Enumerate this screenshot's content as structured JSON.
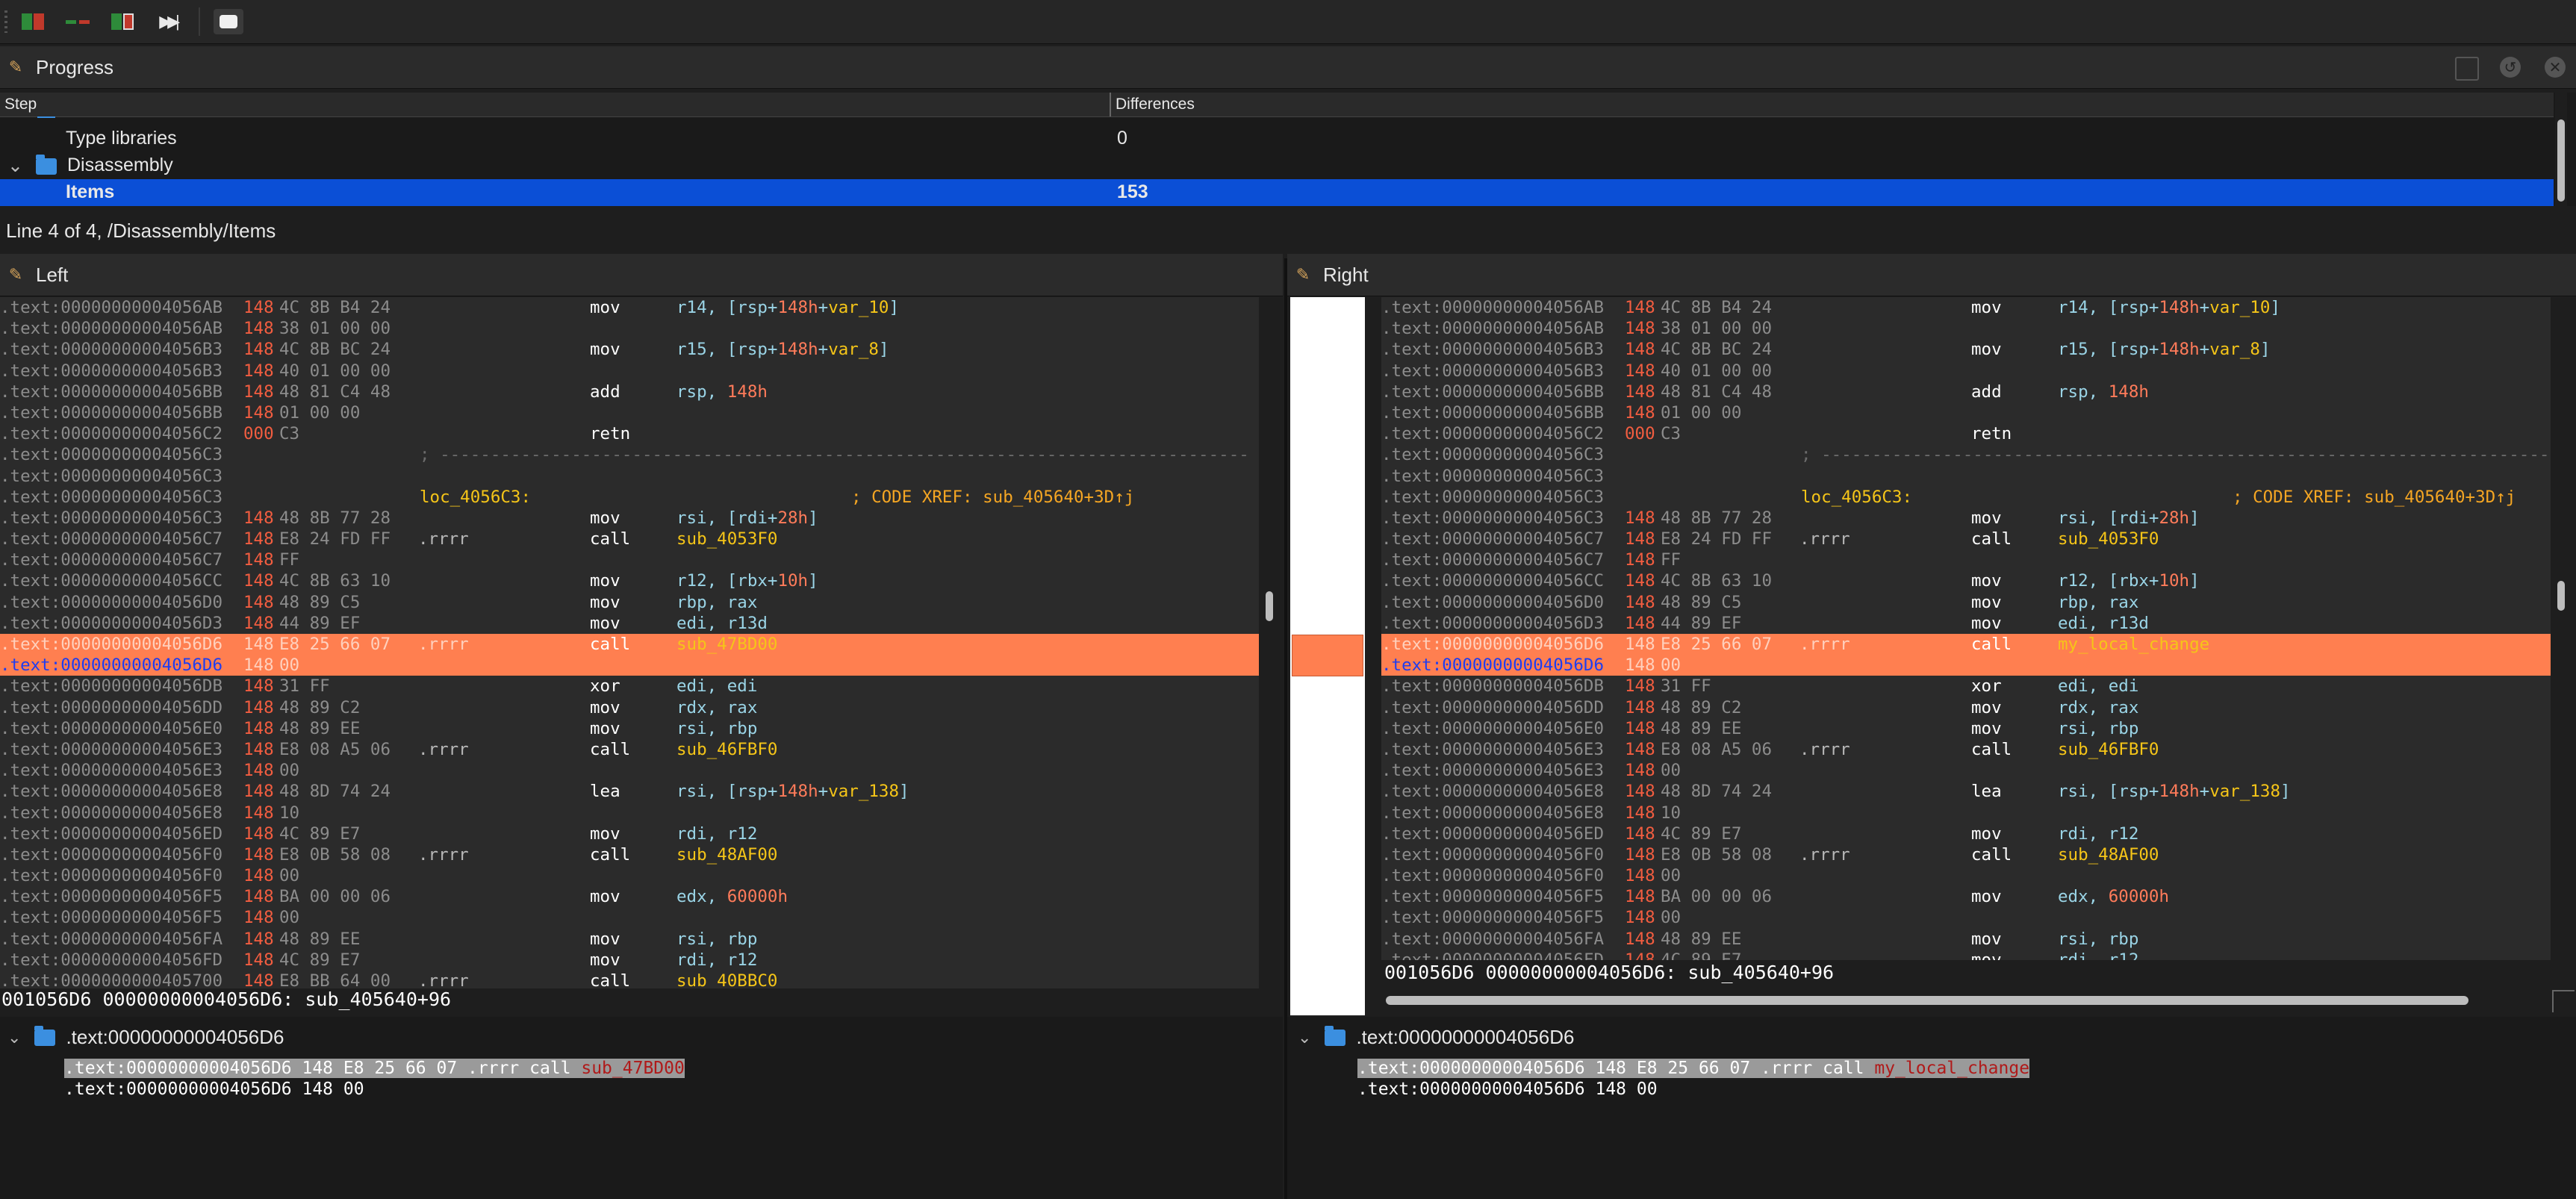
{
  "toolbar": {
    "buttons": [
      {
        "name": "open-diff-icon"
      },
      {
        "name": "prev-diff-icon"
      },
      {
        "name": "next-diff-icon"
      },
      {
        "name": "fast-forward-icon"
      },
      {
        "name": "comment-icon"
      }
    ]
  },
  "progress": {
    "title": "Progress",
    "columns": [
      "Step",
      "Differences"
    ],
    "rows": [
      {
        "step": "Type libraries",
        "diff": "0"
      },
      {
        "step": "Disassembly",
        "diff": ""
      },
      {
        "step": "Items",
        "diff": "153"
      }
    ],
    "status": "Line 4 of 4, /Disassembly/Items"
  },
  "left": {
    "title": "Left",
    "status": "001056D6 00000000004056D6: sub_405640+96",
    "tree_header": ".text:00000000004056D6",
    "tree_line1_pre": ".text:00000000004056D6 148 E8 25 66 07 .rrrr call ",
    "tree_line1_sym": "sub_47BD00",
    "tree_line2": ".text:00000000004056D6 148 00",
    "lines": [
      {
        "a": ".text:00000000004056AB",
        "c": "148",
        "b": "4C 8B B4 24",
        "m": "mov",
        "o": [
          [
            "op",
            "r14, [rsp+"
          ],
          [
            "num",
            "148h"
          ],
          [
            "op",
            "+"
          ],
          [
            "lbl",
            "var_10"
          ],
          [
            "op",
            "]"
          ]
        ]
      },
      {
        "a": ".text:00000000004056AB",
        "c": "148",
        "b": "38 01 00 00"
      },
      {
        "a": ".text:00000000004056B3",
        "c": "148",
        "b": "4C 8B BC 24",
        "m": "mov",
        "o": [
          [
            "op",
            "r15, [rsp+"
          ],
          [
            "num",
            "148h"
          ],
          [
            "op",
            "+"
          ],
          [
            "lbl",
            "var_8"
          ],
          [
            "op",
            "]"
          ]
        ]
      },
      {
        "a": ".text:00000000004056B3",
        "c": "148",
        "b": "40 01 00 00"
      },
      {
        "a": ".text:00000000004056BB",
        "c": "148",
        "b": "48 81 C4 48",
        "m": "add",
        "o": [
          [
            "op",
            "rsp, "
          ],
          [
            "num",
            "148h"
          ]
        ]
      },
      {
        "a": ".text:00000000004056BB",
        "c": "148",
        "b": "01 00 00"
      },
      {
        "a": ".text:00000000004056C2",
        "c": "000",
        "b": "C3",
        "m": "retn"
      },
      {
        "a": ".text:00000000004056C3",
        "sep": true
      },
      {
        "a": ".text:00000000004056C3"
      },
      {
        "a": ".text:00000000004056C3",
        "label": "loc_4056C3:",
        "cmt": "; CODE XREF: sub_405640+3D↑j"
      },
      {
        "a": ".text:00000000004056C3",
        "c": "148",
        "b": "48 8B 77 28",
        "m": "mov",
        "o": [
          [
            "op",
            "rsi, [rdi+"
          ],
          [
            "num",
            "28h"
          ],
          [
            "op",
            "]"
          ]
        ]
      },
      {
        "a": ".text:00000000004056C7",
        "c": "148",
        "b": "E8 24 FD FF",
        "r": ".rrrr",
        "m": "call",
        "o": [
          [
            "lbl",
            "sub_4053F0"
          ]
        ]
      },
      {
        "a": ".text:00000000004056C7",
        "c": "148",
        "b": "FF"
      },
      {
        "a": ".text:00000000004056CC",
        "c": "148",
        "b": "4C 8B 63 10",
        "m": "mov",
        "o": [
          [
            "op",
            "r12, [rbx+"
          ],
          [
            "num",
            "10h"
          ],
          [
            "op",
            "]"
          ]
        ]
      },
      {
        "a": ".text:00000000004056D0",
        "c": "148",
        "b": "48 89 C5",
        "m": "mov",
        "o": [
          [
            "op",
            "rbp, rax"
          ]
        ]
      },
      {
        "a": ".text:00000000004056D3",
        "c": "148",
        "b": "44 89 EF",
        "m": "mov",
        "o": [
          [
            "op",
            "edi, r13d"
          ]
        ]
      },
      {
        "a": ".text:00000000004056D6",
        "c": "148",
        "b": "E8 25 66 07",
        "r": ".rrrr",
        "m": "call",
        "o": [
          [
            "lbl",
            "sub_47BD00"
          ]
        ],
        "hl": 1
      },
      {
        "a": ".text:00000000004056D6",
        "c": "148",
        "b": "00",
        "hl": 2
      },
      {
        "a": ".text:00000000004056DB",
        "c": "148",
        "b": "31 FF",
        "m": "xor",
        "o": [
          [
            "op",
            "edi, edi"
          ]
        ]
      },
      {
        "a": ".text:00000000004056DD",
        "c": "148",
        "b": "48 89 C2",
        "m": "mov",
        "o": [
          [
            "op",
            "rdx, rax"
          ]
        ]
      },
      {
        "a": ".text:00000000004056E0",
        "c": "148",
        "b": "48 89 EE",
        "m": "mov",
        "o": [
          [
            "op",
            "rsi, rbp"
          ]
        ]
      },
      {
        "a": ".text:00000000004056E3",
        "c": "148",
        "b": "E8 08 A5 06",
        "r": ".rrrr",
        "m": "call",
        "o": [
          [
            "lbl",
            "sub_46FBF0"
          ]
        ]
      },
      {
        "a": ".text:00000000004056E3",
        "c": "148",
        "b": "00"
      },
      {
        "a": ".text:00000000004056E8",
        "c": "148",
        "b": "48 8D 74 24",
        "m": "lea",
        "o": [
          [
            "op",
            "rsi, [rsp+"
          ],
          [
            "num",
            "148h"
          ],
          [
            "op",
            "+"
          ],
          [
            "lbl",
            "var_138"
          ],
          [
            "op",
            "]"
          ]
        ]
      },
      {
        "a": ".text:00000000004056E8",
        "c": "148",
        "b": "10"
      },
      {
        "a": ".text:00000000004056ED",
        "c": "148",
        "b": "4C 89 E7",
        "m": "mov",
        "o": [
          [
            "op",
            "rdi, r12"
          ]
        ]
      },
      {
        "a": ".text:00000000004056F0",
        "c": "148",
        "b": "E8 0B 58 08",
        "r": ".rrrr",
        "m": "call",
        "o": [
          [
            "lbl",
            "sub_48AF00"
          ]
        ]
      },
      {
        "a": ".text:00000000004056F0",
        "c": "148",
        "b": "00"
      },
      {
        "a": ".text:00000000004056F5",
        "c": "148",
        "b": "BA 00 00 06",
        "m": "mov",
        "o": [
          [
            "op",
            "edx, "
          ],
          [
            "num",
            "60000h"
          ]
        ]
      },
      {
        "a": ".text:00000000004056F5",
        "c": "148",
        "b": "00"
      },
      {
        "a": ".text:00000000004056FA",
        "c": "148",
        "b": "48 89 EE",
        "m": "mov",
        "o": [
          [
            "op",
            "rsi, rbp"
          ]
        ]
      },
      {
        "a": ".text:00000000004056FD",
        "c": "148",
        "b": "4C 89 E7",
        "m": "mov",
        "o": [
          [
            "op",
            "rdi, r12"
          ]
        ]
      },
      {
        "a": ".text:0000000000405700",
        "c": "148",
        "b": "E8 BB 64 00",
        "r": ".rrrr",
        "m": "call",
        "o": [
          [
            "lbl",
            "sub_40BBC0"
          ]
        ]
      }
    ]
  },
  "right": {
    "title": "Right",
    "status": "001056D6 00000000004056D6: sub_405640+96",
    "tree_header": ".text:00000000004056D6",
    "tree_line1_pre": ".text:00000000004056D6 148 E8 25 66 07 .rrrr call ",
    "tree_line1_sym": "my_local_change",
    "tree_line2": ".text:00000000004056D6 148 00",
    "lines": [
      {
        "a": ".text:00000000004056AB",
        "c": "148",
        "b": "4C 8B B4 24",
        "m": "mov",
        "o": [
          [
            "op",
            "r14, [rsp+"
          ],
          [
            "num",
            "148h"
          ],
          [
            "op",
            "+"
          ],
          [
            "lbl",
            "var_10"
          ],
          [
            "op",
            "]"
          ]
        ]
      },
      {
        "a": ".text:00000000004056AB",
        "c": "148",
        "b": "38 01 00 00"
      },
      {
        "a": ".text:00000000004056B3",
        "c": "148",
        "b": "4C 8B BC 24",
        "m": "mov",
        "o": [
          [
            "op",
            "r15, [rsp+"
          ],
          [
            "num",
            "148h"
          ],
          [
            "op",
            "+"
          ],
          [
            "lbl",
            "var_8"
          ],
          [
            "op",
            "]"
          ]
        ]
      },
      {
        "a": ".text:00000000004056B3",
        "c": "148",
        "b": "40 01 00 00"
      },
      {
        "a": ".text:00000000004056BB",
        "c": "148",
        "b": "48 81 C4 48",
        "m": "add",
        "o": [
          [
            "op",
            "rsp, "
          ],
          [
            "num",
            "148h"
          ]
        ]
      },
      {
        "a": ".text:00000000004056BB",
        "c": "148",
        "b": "01 00 00"
      },
      {
        "a": ".text:00000000004056C2",
        "c": "000",
        "b": "C3",
        "m": "retn"
      },
      {
        "a": ".text:00000000004056C3",
        "sep": true
      },
      {
        "a": ".text:00000000004056C3"
      },
      {
        "a": ".text:00000000004056C3",
        "label": "loc_4056C3:",
        "cmt": "; CODE XREF: sub_405640+3D↑j"
      },
      {
        "a": ".text:00000000004056C3",
        "c": "148",
        "b": "48 8B 77 28",
        "m": "mov",
        "o": [
          [
            "op",
            "rsi, [rdi+"
          ],
          [
            "num",
            "28h"
          ],
          [
            "op",
            "]"
          ]
        ]
      },
      {
        "a": ".text:00000000004056C7",
        "c": "148",
        "b": "E8 24 FD FF",
        "r": ".rrrr",
        "m": "call",
        "o": [
          [
            "lbl",
            "sub_4053F0"
          ]
        ]
      },
      {
        "a": ".text:00000000004056C7",
        "c": "148",
        "b": "FF"
      },
      {
        "a": ".text:00000000004056CC",
        "c": "148",
        "b": "4C 8B 63 10",
        "m": "mov",
        "o": [
          [
            "op",
            "r12, [rbx+"
          ],
          [
            "num",
            "10h"
          ],
          [
            "op",
            "]"
          ]
        ]
      },
      {
        "a": ".text:00000000004056D0",
        "c": "148",
        "b": "48 89 C5",
        "m": "mov",
        "o": [
          [
            "op",
            "rbp, rax"
          ]
        ]
      },
      {
        "a": ".text:00000000004056D3",
        "c": "148",
        "b": "44 89 EF",
        "m": "mov",
        "o": [
          [
            "op",
            "edi, r13d"
          ]
        ]
      },
      {
        "a": ".text:00000000004056D6",
        "c": "148",
        "b": "E8 25 66 07",
        "r": ".rrrr",
        "m": "call",
        "o": [
          [
            "lbl",
            "my_local_change"
          ]
        ],
        "hl": 1
      },
      {
        "a": ".text:00000000004056D6",
        "c": "148",
        "b": "00",
        "hl": 2
      },
      {
        "a": ".text:00000000004056DB",
        "c": "148",
        "b": "31 FF",
        "m": "xor",
        "o": [
          [
            "op",
            "edi, edi"
          ]
        ]
      },
      {
        "a": ".text:00000000004056DD",
        "c": "148",
        "b": "48 89 C2",
        "m": "mov",
        "o": [
          [
            "op",
            "rdx, rax"
          ]
        ]
      },
      {
        "a": ".text:00000000004056E0",
        "c": "148",
        "b": "48 89 EE",
        "m": "mov",
        "o": [
          [
            "op",
            "rsi, rbp"
          ]
        ]
      },
      {
        "a": ".text:00000000004056E3",
        "c": "148",
        "b": "E8 08 A5 06",
        "r": ".rrrr",
        "m": "call",
        "o": [
          [
            "lbl",
            "sub_46FBF0"
          ]
        ]
      },
      {
        "a": ".text:00000000004056E3",
        "c": "148",
        "b": "00"
      },
      {
        "a": ".text:00000000004056E8",
        "c": "148",
        "b": "48 8D 74 24",
        "m": "lea",
        "o": [
          [
            "op",
            "rsi, [rsp+"
          ],
          [
            "num",
            "148h"
          ],
          [
            "op",
            "+"
          ],
          [
            "lbl",
            "var_138"
          ],
          [
            "op",
            "]"
          ]
        ]
      },
      {
        "a": ".text:00000000004056E8",
        "c": "148",
        "b": "10"
      },
      {
        "a": ".text:00000000004056ED",
        "c": "148",
        "b": "4C 89 E7",
        "m": "mov",
        "o": [
          [
            "op",
            "rdi, r12"
          ]
        ]
      },
      {
        "a": ".text:00000000004056F0",
        "c": "148",
        "b": "E8 0B 58 08",
        "r": ".rrrr",
        "m": "call",
        "o": [
          [
            "lbl",
            "sub_48AF00"
          ]
        ]
      },
      {
        "a": ".text:00000000004056F0",
        "c": "148",
        "b": "00"
      },
      {
        "a": ".text:00000000004056F5",
        "c": "148",
        "b": "BA 00 00 06",
        "m": "mov",
        "o": [
          [
            "op",
            "edx, "
          ],
          [
            "num",
            "60000h"
          ]
        ]
      },
      {
        "a": ".text:00000000004056F5",
        "c": "148",
        "b": "00"
      },
      {
        "a": ".text:00000000004056FA",
        "c": "148",
        "b": "48 89 EE",
        "m": "mov",
        "o": [
          [
            "op",
            "rsi, rbp"
          ]
        ]
      },
      {
        "a": ".text:00000000004056FD",
        "c": "148",
        "b": "4C 89 E7",
        "m": "mov",
        "o": [
          [
            "op",
            "rdi, r12"
          ]
        ]
      }
    ]
  },
  "colors": {
    "highlight": "#ff7f50",
    "selection": "#0b4fd6",
    "label": "#f5c518",
    "count": "#f25d40"
  }
}
